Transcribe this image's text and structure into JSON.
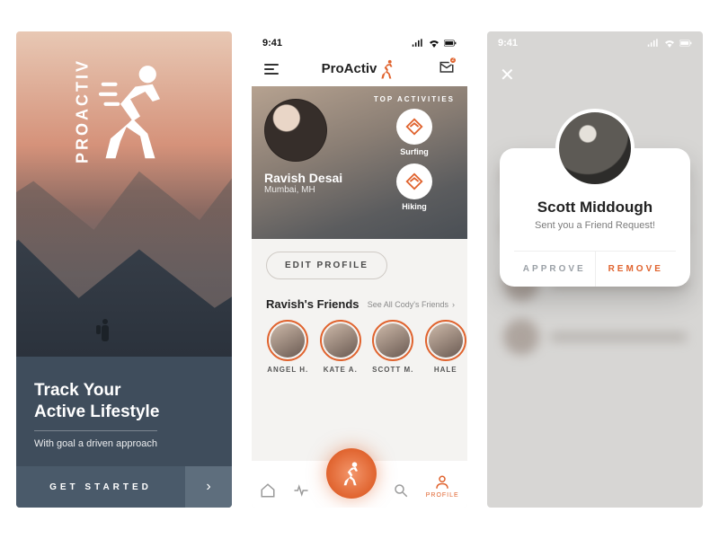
{
  "statusbar_time": "9:41",
  "accent": "#e0632e",
  "onboard": {
    "brand": "PROACTIV",
    "headline1": "Track Your",
    "headline2": "Active Lifestyle",
    "sub": "With goal a driven approach",
    "cta": "GET STARTED"
  },
  "profile": {
    "app_name": "ProActiv",
    "notif_count": "2",
    "name": "Ravish Desai",
    "location": "Mumbai, MH",
    "top_label": "TOP ACTIVITIES",
    "activities": [
      {
        "label": "Surfing"
      },
      {
        "label": "Hiking"
      }
    ],
    "edit": "EDIT PROFILE",
    "friends_title": "Ravish's Friends",
    "friends_link": "See All Cody's Friends",
    "friends": [
      {
        "name": "Angel H."
      },
      {
        "name": "KATE A."
      },
      {
        "name": "SCOTT M."
      },
      {
        "name": "HALE"
      }
    ],
    "tabs": {
      "profile": "PROFILE"
    }
  },
  "request": {
    "name": "Scott Middough",
    "msg": "Sent you a Friend Request!",
    "approve": "APPROVE",
    "remove": "REMOVE"
  }
}
